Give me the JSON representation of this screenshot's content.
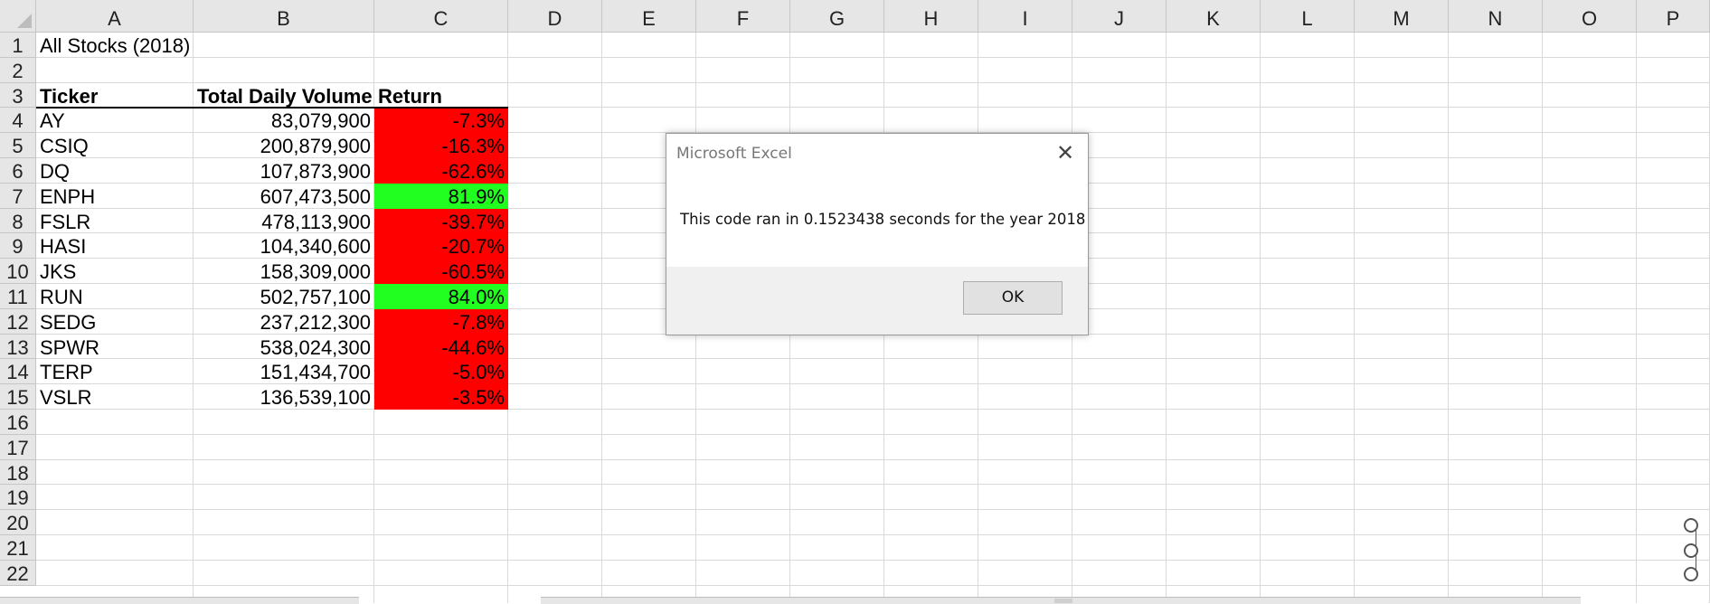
{
  "columns": [
    "A",
    "B",
    "C",
    "D",
    "E",
    "F",
    "G",
    "H",
    "I",
    "J",
    "K",
    "L",
    "M",
    "N",
    "O",
    "P"
  ],
  "rows": [
    "1",
    "2",
    "3",
    "4",
    "5",
    "6",
    "7",
    "8",
    "9",
    "10",
    "11",
    "12",
    "13",
    "14",
    "15",
    "16",
    "17",
    "18",
    "19",
    "20",
    "21",
    "22"
  ],
  "sheet": {
    "title": "All Stocks (2018)",
    "headers": {
      "ticker": "Ticker",
      "volume": "Total Daily Volume",
      "return": "Return"
    },
    "data": [
      {
        "ticker": "AY",
        "volume": "83,079,900",
        "return": "-7.3%"
      },
      {
        "ticker": "CSIQ",
        "volume": "200,879,900",
        "return": "-16.3%"
      },
      {
        "ticker": "DQ",
        "volume": "107,873,900",
        "return": "-62.6%"
      },
      {
        "ticker": "ENPH",
        "volume": "607,473,500",
        "return": "81.9%"
      },
      {
        "ticker": "FSLR",
        "volume": "478,113,900",
        "return": "-39.7%"
      },
      {
        "ticker": "HASI",
        "volume": "104,340,600",
        "return": "-20.7%"
      },
      {
        "ticker": "JKS",
        "volume": "158,309,000",
        "return": "-60.5%"
      },
      {
        "ticker": "RUN",
        "volume": "502,757,100",
        "return": "84.0%"
      },
      {
        "ticker": "SEDG",
        "volume": "237,212,300",
        "return": "-7.8%"
      },
      {
        "ticker": "SPWR",
        "volume": "538,024,300",
        "return": "-44.6%"
      },
      {
        "ticker": "TERP",
        "volume": "151,434,700",
        "return": "-5.0%"
      },
      {
        "ticker": "VSLR",
        "volume": "136,539,100",
        "return": "-3.5%"
      }
    ]
  },
  "colors": {
    "positive": "#21ff21",
    "negative": "#ff0000",
    "header_bg": "#e6e6e6",
    "gridline": "#d9d9d9"
  },
  "dialog": {
    "title": "Microsoft Excel",
    "message": "This code ran in 0.1523438 seconds for the year 2018",
    "ok_label": "OK",
    "close_icon": "close-icon"
  }
}
